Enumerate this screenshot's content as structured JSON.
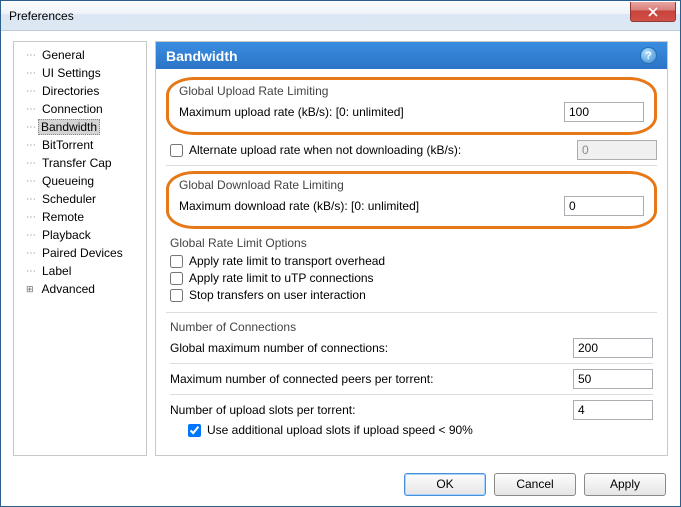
{
  "window": {
    "title": "Preferences"
  },
  "tree": {
    "items": [
      {
        "label": "General"
      },
      {
        "label": "UI Settings"
      },
      {
        "label": "Directories"
      },
      {
        "label": "Connection"
      },
      {
        "label": "Bandwidth",
        "selected": true
      },
      {
        "label": "BitTorrent"
      },
      {
        "label": "Transfer Cap"
      },
      {
        "label": "Queueing"
      },
      {
        "label": "Scheduler"
      },
      {
        "label": "Remote"
      },
      {
        "label": "Playback"
      },
      {
        "label": "Paired Devices"
      },
      {
        "label": "Label"
      },
      {
        "label": "Advanced",
        "expandable": true
      }
    ]
  },
  "panel": {
    "title": "Bandwidth",
    "upload": {
      "title": "Global Upload Rate Limiting",
      "maxLabel": "Maximum upload rate (kB/s): [0: unlimited]",
      "maxValue": "100",
      "altLabel": "Alternate upload rate when not downloading (kB/s):",
      "altValue": "0",
      "altChecked": false
    },
    "download": {
      "title": "Global Download Rate Limiting",
      "maxLabel": "Maximum download rate (kB/s): [0: unlimited]",
      "maxValue": "0"
    },
    "options": {
      "title": "Global Rate Limit Options",
      "overhead": "Apply rate limit to transport overhead",
      "utp": "Apply rate limit to uTP connections",
      "stop": "Stop transfers on user interaction"
    },
    "connections": {
      "title": "Number of Connections",
      "globalMax": "Global maximum number of connections:",
      "globalMaxValue": "200",
      "peersPer": "Maximum number of connected peers per torrent:",
      "peersPerValue": "50",
      "slotsPer": "Number of upload slots per torrent:",
      "slotsPerValue": "4",
      "additional": "Use additional upload slots if upload speed < 90%",
      "additionalChecked": true
    }
  },
  "buttons": {
    "ok": "OK",
    "cancel": "Cancel",
    "apply": "Apply"
  }
}
